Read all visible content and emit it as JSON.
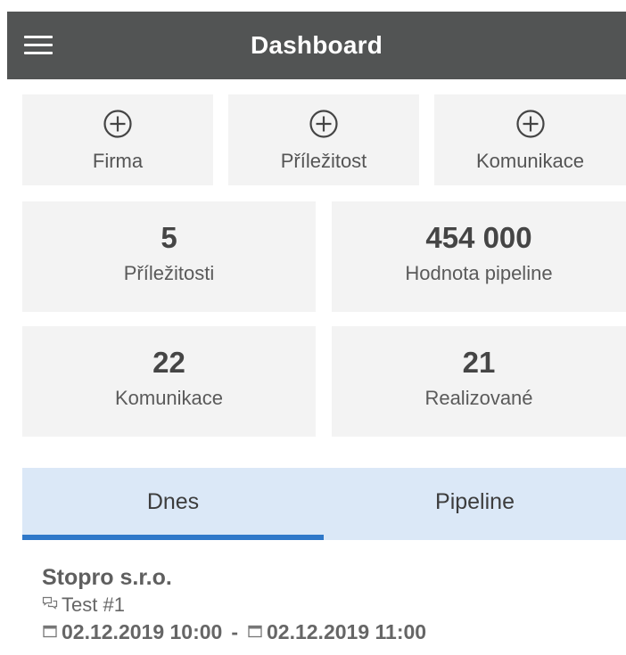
{
  "header": {
    "title": "Dashboard",
    "menu_icon": "hamburger-icon"
  },
  "quick_actions": [
    {
      "icon": "circle-plus-icon",
      "label": "Firma"
    },
    {
      "icon": "circle-plus-icon",
      "label": "Příležitost"
    },
    {
      "icon": "circle-plus-icon",
      "label": "Komunikace"
    }
  ],
  "stats": [
    {
      "value": "5",
      "label": "Příležitosti"
    },
    {
      "value": "454 000",
      "label": "Hodnota pipeline"
    },
    {
      "value": "22",
      "label": "Komunikace"
    },
    {
      "value": "21",
      "label": "Realizované"
    }
  ],
  "tabs": {
    "active": "Dnes",
    "items": [
      {
        "label": "Dnes"
      },
      {
        "label": "Pipeline"
      }
    ],
    "accent_color": "#2f78c9"
  },
  "today": [
    {
      "company": "Stopro s.r.o.",
      "communication": "Test #1",
      "start": "02.12.2019 10:00",
      "separator": "-",
      "end": "02.12.2019 11:00"
    }
  ]
}
